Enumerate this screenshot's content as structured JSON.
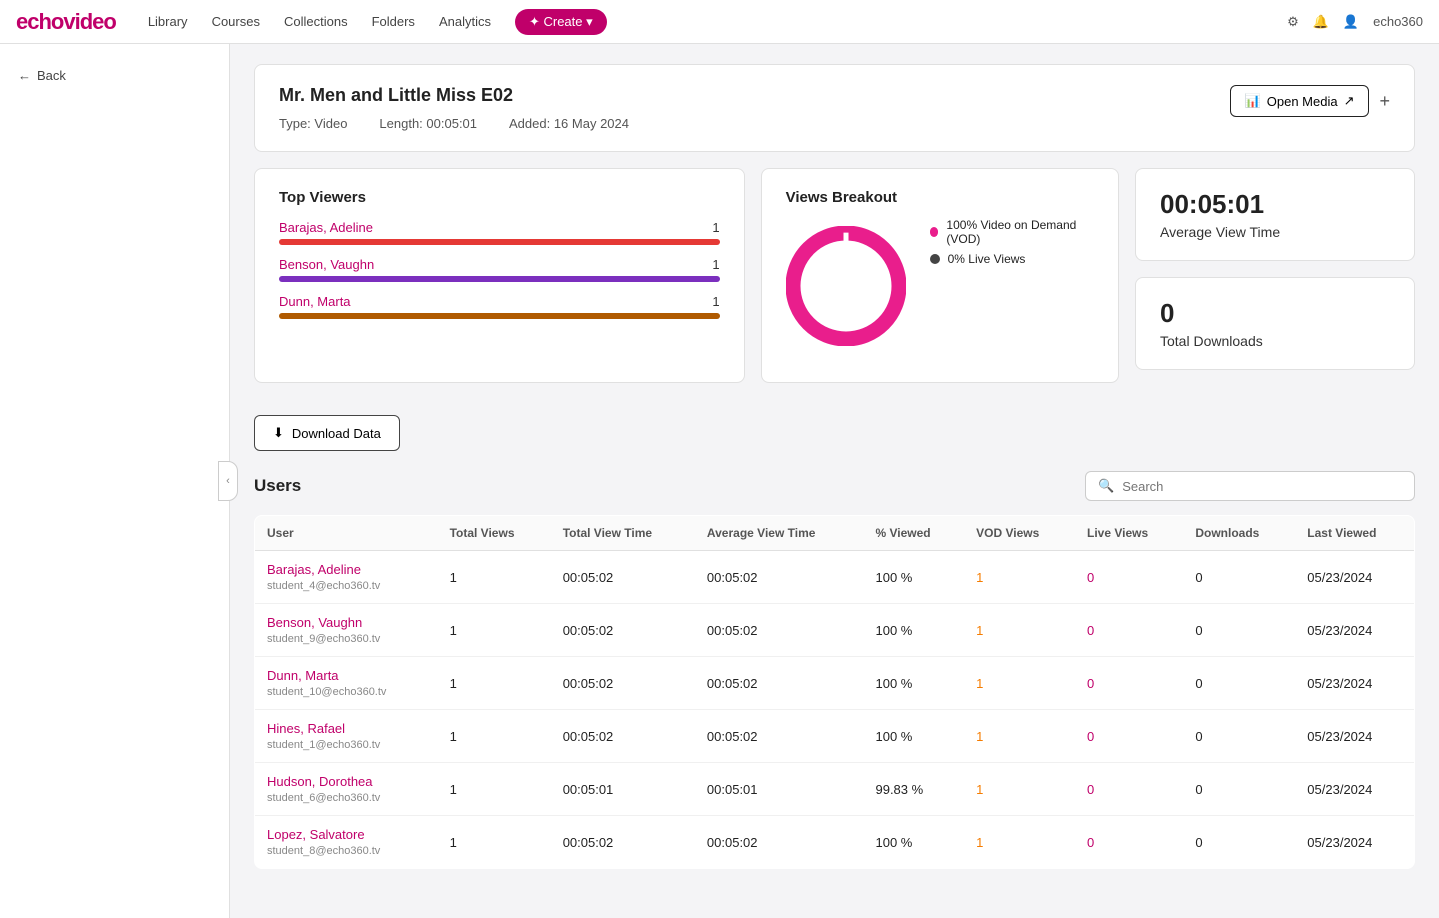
{
  "navbar": {
    "logo": "echovideo",
    "links": [
      "Library",
      "Courses",
      "Collections",
      "Folders",
      "Analytics"
    ],
    "create_label": "✦ Create ▾",
    "settings_icon": "⚙",
    "bell_icon": "🔔",
    "user_icon": "👤",
    "user_name": "echo360"
  },
  "sidebar": {
    "back_label": "Back"
  },
  "media": {
    "title": "Mr. Men and Little Miss E02",
    "type": "Type: Video",
    "length": "Length: 00:05:01",
    "added": "Added: 16 May 2024",
    "open_media_label": "Open Media"
  },
  "top_viewers": {
    "title": "Top Viewers",
    "viewers": [
      {
        "name": "Barajas, Adeline",
        "count": 1,
        "color": "#e53935",
        "pct": 100
      },
      {
        "name": "Benson, Vaughn",
        "count": 1,
        "color": "#7b2fbe",
        "pct": 100
      },
      {
        "name": "Dunn, Marta",
        "count": 1,
        "color": "#b05a00",
        "pct": 100
      }
    ]
  },
  "views_breakout": {
    "title": "Views Breakout",
    "legend": [
      {
        "label": "100% Video on Demand (VOD)",
        "color": "#e91e8c"
      },
      {
        "label": "0% Live Views",
        "color": "#444"
      }
    ]
  },
  "avg_view_time": {
    "value": "00:05:01",
    "label": "Average View Time"
  },
  "total_downloads": {
    "value": "0",
    "label": "Total Downloads"
  },
  "download_btn": "Download Data",
  "users_section": {
    "title": "Users",
    "search_placeholder": "Search",
    "table_headers": [
      "User",
      "Total Views",
      "Total View Time",
      "Average View Time",
      "% Viewed",
      "VOD Views",
      "Live Views",
      "Downloads",
      "Last Viewed"
    ],
    "rows": [
      {
        "name": "Barajas, Adeline",
        "email": "student_4@echo360.tv",
        "total_views": 1,
        "total_view_time": "00:05:02",
        "avg_view_time": "00:05:02",
        "pct_viewed": "100 %",
        "vod_views": 1,
        "live_views": 0,
        "downloads": 0,
        "last_viewed": "05/23/2024"
      },
      {
        "name": "Benson, Vaughn",
        "email": "student_9@echo360.tv",
        "total_views": 1,
        "total_view_time": "00:05:02",
        "avg_view_time": "00:05:02",
        "pct_viewed": "100 %",
        "vod_views": 1,
        "live_views": 0,
        "downloads": 0,
        "last_viewed": "05/23/2024"
      },
      {
        "name": "Dunn, Marta",
        "email": "student_10@echo360.tv",
        "total_views": 1,
        "total_view_time": "00:05:02",
        "avg_view_time": "00:05:02",
        "pct_viewed": "100 %",
        "vod_views": 1,
        "live_views": 0,
        "downloads": 0,
        "last_viewed": "05/23/2024"
      },
      {
        "name": "Hines, Rafael",
        "email": "student_1@echo360.tv",
        "total_views": 1,
        "total_view_time": "00:05:02",
        "avg_view_time": "00:05:02",
        "pct_viewed": "100 %",
        "vod_views": 1,
        "live_views": 0,
        "downloads": 0,
        "last_viewed": "05/23/2024"
      },
      {
        "name": "Hudson, Dorothea",
        "email": "student_6@echo360.tv",
        "total_views": 1,
        "total_view_time": "00:05:01",
        "avg_view_time": "00:05:01",
        "pct_viewed": "99.83 %",
        "vod_views": 1,
        "live_views": 0,
        "downloads": 0,
        "last_viewed": "05/23/2024"
      },
      {
        "name": "Lopez, Salvatore",
        "email": "student_8@echo360.tv",
        "total_views": 1,
        "total_view_time": "00:05:02",
        "avg_view_time": "00:05:02",
        "pct_viewed": "100 %",
        "vod_views": 1,
        "live_views": 0,
        "downloads": 0,
        "last_viewed": "05/23/2024"
      }
    ]
  }
}
